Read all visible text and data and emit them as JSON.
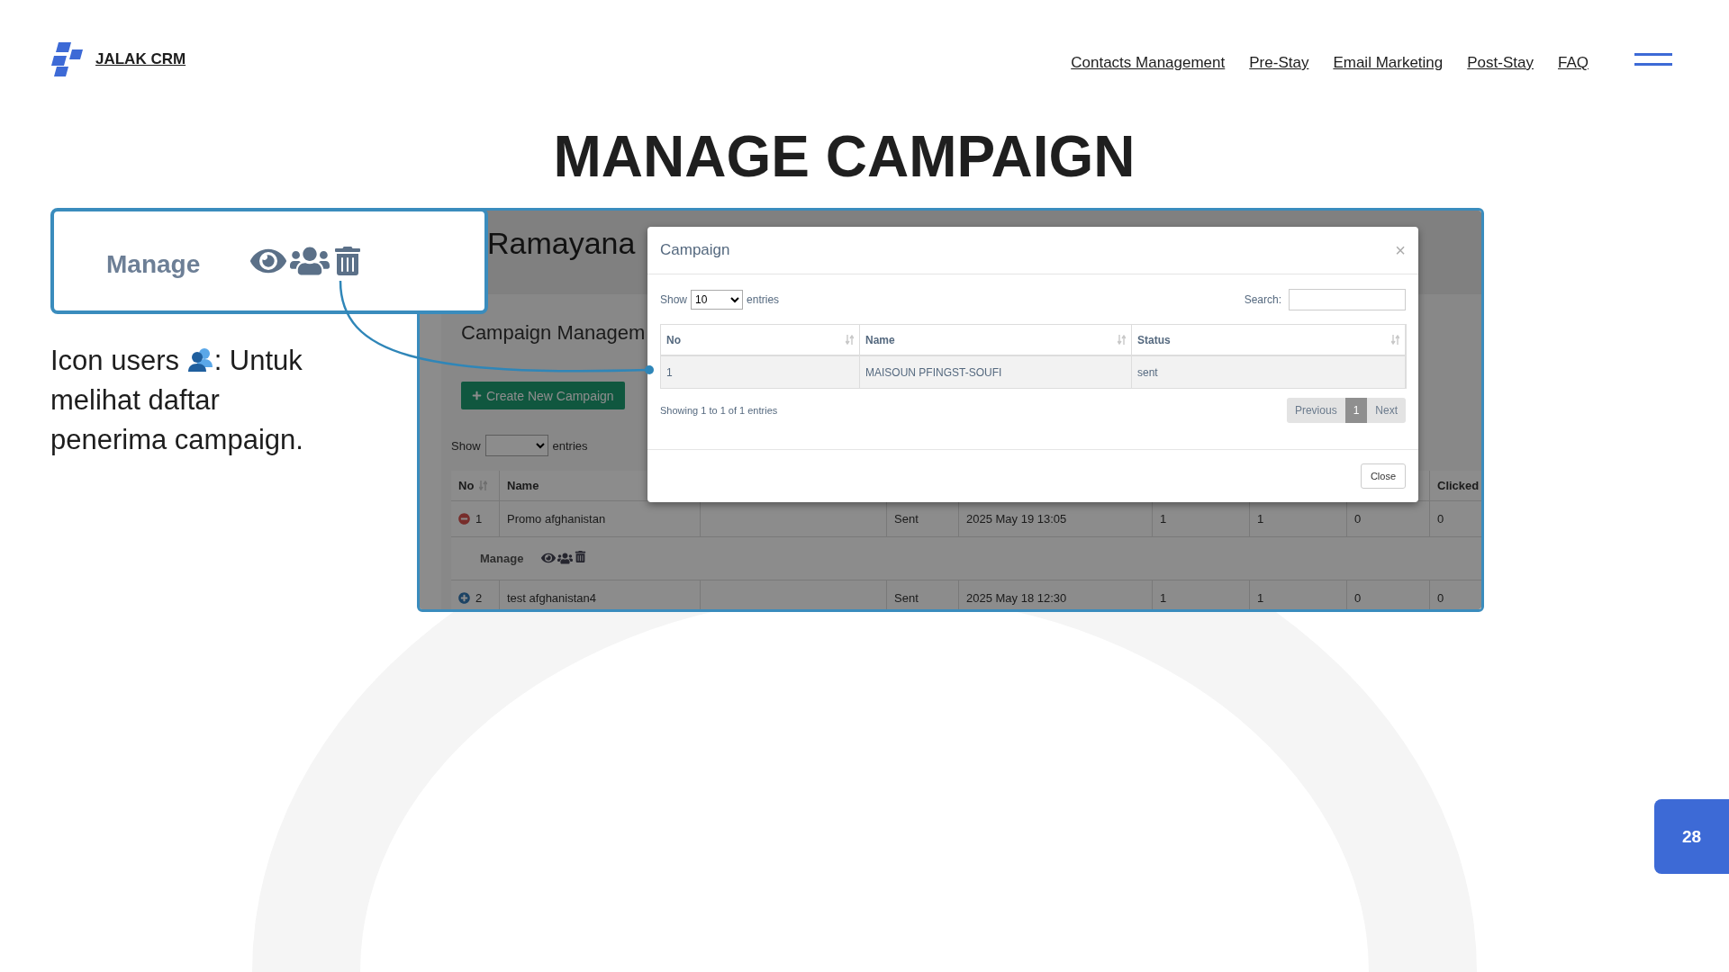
{
  "header": {
    "brand": "JALAK CRM",
    "nav": [
      "Contacts Management",
      "Pre-Stay",
      "Email Marketing",
      "Post-Stay",
      "FAQ"
    ]
  },
  "title": "MANAGE CAMPAIGN",
  "callout": {
    "label": "Manage"
  },
  "caption": {
    "before": "Icon users",
    "after": ": Untuk",
    "rest": "melihat daftar penerima campaign."
  },
  "screenshot": {
    "app_title": "Ramayana",
    "card_title": "Campaign Managem",
    "create_button": "Create New Campaign",
    "show_label": "Show",
    "entries_label": "entries",
    "header": {
      "no": "No",
      "name": "Name",
      "clicked": "Clicked"
    },
    "rows": [
      {
        "expanded": true,
        "no": "1",
        "name": "Promo afghanistan",
        "status": "Sent",
        "date": "2025 May 19 13:05",
        "col_6": "1",
        "col_7": "1",
        "col_8": "0",
        "clicked": "0",
        "manage_label": "Manage"
      },
      {
        "expanded": false,
        "no": "2",
        "name": "test afghanistan4",
        "status": "Sent",
        "date": "2025 May 18 12:30",
        "col_6": "1",
        "col_7": "1",
        "col_8": "0",
        "clicked": "0"
      }
    ],
    "modal": {
      "title": "Campaign",
      "close_icon": "×",
      "show_label": "Show",
      "page_size": "10",
      "entries_label": "entries",
      "search_label": "Search:",
      "columns": [
        "No",
        "Name",
        "Status"
      ],
      "rows": [
        [
          "1",
          "MAISOUN PFINGST-SOUFI",
          "sent"
        ]
      ],
      "info": "Showing 1 to 1 of 1 entries",
      "pagination": [
        {
          "label": "Previous",
          "selected": false
        },
        {
          "label": "1",
          "selected": true
        },
        {
          "label": "Next",
          "selected": false
        }
      ],
      "close_button": "Close"
    }
  },
  "page_number": "28"
}
